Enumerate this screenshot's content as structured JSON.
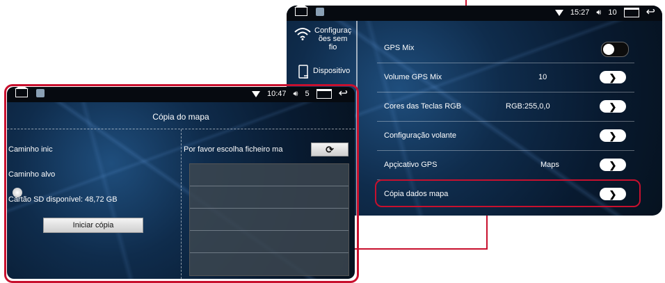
{
  "settings_screen": {
    "status": {
      "time": "15:27",
      "volume": "10"
    },
    "sidebar": [
      {
        "icon": "wifi-icon",
        "label_lines": [
          "Configuraç",
          "ões sem",
          "fio"
        ]
      },
      {
        "icon": "device-icon",
        "label_lines": [
          "Dispositivo"
        ]
      }
    ],
    "rows": [
      {
        "label": "GPS Mix",
        "value": "",
        "control": "toggle",
        "state": "off"
      },
      {
        "label": "Volume GPS Mix",
        "value": "10",
        "control": "arrow"
      },
      {
        "label": "Cores das Teclas RGB",
        "value": "RGB:255,0,0",
        "control": "arrow"
      },
      {
        "label": "Configuração volante",
        "value": "",
        "control": "arrow"
      },
      {
        "label": "Apçicativo GPS",
        "value": "Maps",
        "control": "arrow"
      },
      {
        "label": "Cópia dados mapa",
        "value": "",
        "control": "arrow"
      }
    ]
  },
  "copy_screen": {
    "status": {
      "time": "10:47",
      "volume": "5"
    },
    "title": "Cópia do mapa",
    "source_label": "Caminho inic",
    "target_label": "Caminho alvo",
    "sd_label": "Cartão SD disponível: 48,72 GB",
    "start_button": "Iniciar cópia",
    "choose_file_label": "Por favor escolha ficheiro ma",
    "file_list_rows": 5
  },
  "accent_color": "#c8102e"
}
